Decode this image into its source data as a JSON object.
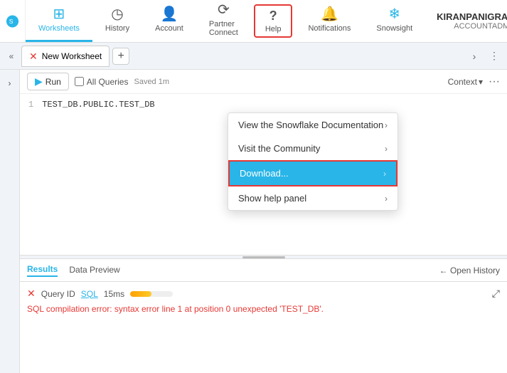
{
  "nav": {
    "items": [
      {
        "id": "worksheets",
        "label": "Worksheets",
        "icon": "⊞",
        "active": true
      },
      {
        "id": "history",
        "label": "History",
        "icon": "◷",
        "active": false
      },
      {
        "id": "account",
        "label": "Account",
        "icon": "👤",
        "active": false
      },
      {
        "id": "partner-connect",
        "label": "Partner Connect",
        "icon": "⟳",
        "active": false
      },
      {
        "id": "help",
        "label": "Help",
        "icon": "?",
        "active": false,
        "highlighted": true
      },
      {
        "id": "notifications",
        "label": "Notifications",
        "icon": "🔔",
        "active": false
      },
      {
        "id": "snowsight",
        "label": "Snowsight",
        "icon": "❄",
        "active": false
      }
    ],
    "user": {
      "name": "KIRANPANIGRAHI",
      "role": "ACCOUNTADMIN"
    }
  },
  "tab": {
    "label": "New Worksheet",
    "close_icon": "✕",
    "add_icon": "+"
  },
  "toolbar": {
    "run_label": "Run",
    "all_queries_label": "All Queries",
    "saved_label": "Saved 1m",
    "context_label": "Context",
    "context_arrow": "▾"
  },
  "code": {
    "line_number": "1",
    "content": "TEST_DB.PUBLIC.TEST_DB"
  },
  "results": {
    "tabs": [
      {
        "label": "Results",
        "active": true
      },
      {
        "label": "Data Preview",
        "active": false
      }
    ],
    "open_history_label": "← Open History",
    "query_x": "✕",
    "query_id_label": "Query ID",
    "query_sql_label": "SQL",
    "query_time": "15ms",
    "progress_fill_width": "50%",
    "error_text": "SQL compilation error: syntax error line 1 at position 0 unexpected 'TEST_DB'.",
    "expand_icon": "⤢"
  },
  "dropdown": {
    "items": [
      {
        "label": "View the Snowflake Documentation",
        "has_chevron": true,
        "selected": false
      },
      {
        "label": "Visit the Community",
        "has_chevron": true,
        "selected": false
      },
      {
        "label": "Download...",
        "has_chevron": true,
        "selected": true
      },
      {
        "label": "Show help panel",
        "has_chevron": true,
        "selected": false
      }
    ]
  },
  "colors": {
    "accent": "#29b5e8",
    "error": "#e53935",
    "highlight_border": "#e53935",
    "selected_bg": "#29b5e8"
  }
}
